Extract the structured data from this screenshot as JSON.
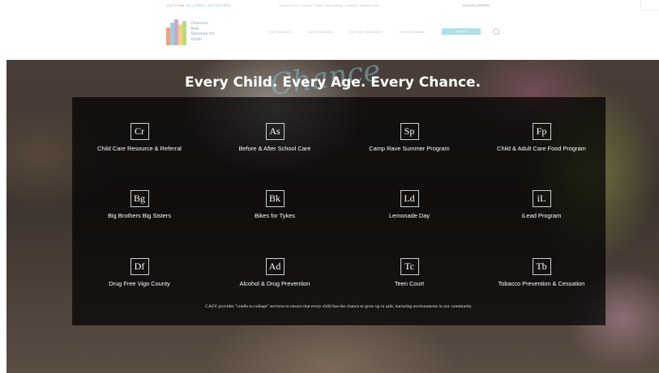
{
  "topbar": {
    "phone_label": "24/7 Crisis",
    "phone_text": "TOLL FREE 1-800-000-0000",
    "links_text": "Careers at CASY · Volunteer · Donate · Event Calendar · Contact Us · Employee Portal",
    "lang_text": "ENGLISH | ESPAÑOL"
  },
  "header": {
    "logo_lines": [
      "Chances",
      "And",
      "Services for",
      "Youth"
    ],
    "nav": [
      "FOR FAMILIES",
      "FOR PROVIDERS",
      "FOR THE COMMUNITY",
      "FOR PROGRAMS"
    ],
    "donate_label": "DONATE",
    "brand_colors": [
      "#f2a07a",
      "#9ad0de",
      "#c7a9d6",
      "#f5d36a",
      "#b5d98a"
    ]
  },
  "hero": {
    "title": "Every Child. Every Age. Every Chance.",
    "script_word": "Chance",
    "programs": [
      {
        "abbr": "Cr",
        "label": "Child Care Resource & Referral"
      },
      {
        "abbr": "As",
        "label": "Before & After School Care"
      },
      {
        "abbr": "Sp",
        "label": "Camp Rave Summer Program"
      },
      {
        "abbr": "Fp",
        "label": "Child & Adult Care Food Program"
      },
      {
        "abbr": "Bg",
        "label": "Big Brothers Big Sisters"
      },
      {
        "abbr": "Bk",
        "label": "Bikes for Tykes"
      },
      {
        "abbr": "Ld",
        "label": "Lemonade Day"
      },
      {
        "abbr": "iL",
        "label": "iLead Program"
      },
      {
        "abbr": "Df",
        "label": "Drug Free Vigo County"
      },
      {
        "abbr": "Ad",
        "label": "Alcohol & Drug Prevention"
      },
      {
        "abbr": "Tc",
        "label": "Teen Court"
      },
      {
        "abbr": "Tb",
        "label": "Tobacco Prevention & Cessation"
      }
    ],
    "tagline": "CASY provides \"cradle to college\" services to ensure that every child has the chance to grow up in safe, nurturing environments in our community."
  }
}
